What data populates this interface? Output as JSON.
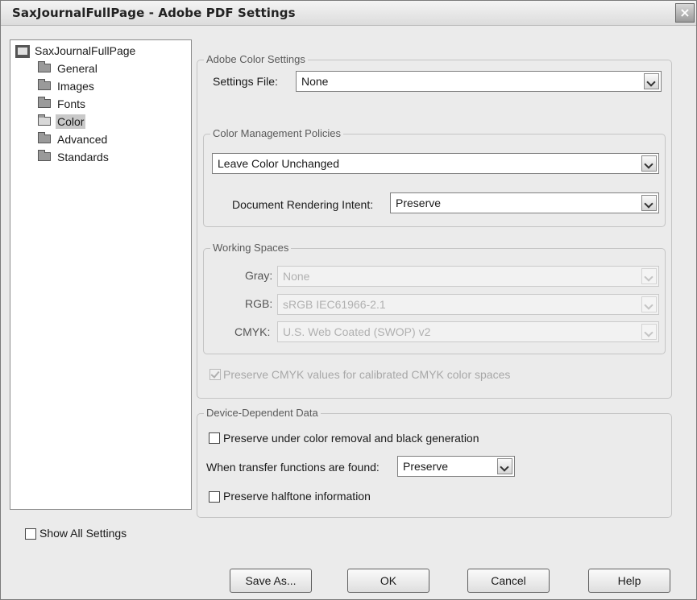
{
  "window": {
    "title": "SaxJournalFullPage - Adobe PDF Settings",
    "close_glyph": "×"
  },
  "tree": {
    "root": {
      "label": "SaxJournalFullPage",
      "icon": "settings-file-icon"
    },
    "items": [
      {
        "label": "General",
        "icon": "folder-icon"
      },
      {
        "label": "Images",
        "icon": "folder-icon"
      },
      {
        "label": "Fonts",
        "icon": "folder-icon"
      },
      {
        "label": "Color",
        "icon": "open-folder-icon",
        "selected": true
      },
      {
        "label": "Advanced",
        "icon": "folder-icon"
      },
      {
        "label": "Standards",
        "icon": "folder-icon"
      }
    ]
  },
  "color_settings": {
    "legend": "Adobe Color Settings",
    "settings_file_label": "Settings File:",
    "settings_file_value": "None"
  },
  "policies": {
    "legend": "Color Management Policies",
    "policy_value": "Leave Color Unchanged",
    "intent_label": "Document Rendering Intent:",
    "intent_value": "Preserve"
  },
  "working_spaces": {
    "legend": "Working Spaces",
    "gray_label": "Gray:",
    "gray_value": "None",
    "rgb_label": "RGB:",
    "rgb_value": "sRGB IEC61966-2.1",
    "cmyk_label": "CMYK:",
    "cmyk_value": "U.S. Web Coated (SWOP) v2"
  },
  "preserve_cmyk": {
    "label": "Preserve CMYK values for calibrated CMYK color spaces",
    "checked": true,
    "enabled": false
  },
  "device": {
    "legend": "Device-Dependent Data",
    "ucr_label": "Preserve under color removal and black generation",
    "ucr_checked": false,
    "transfer_label": "When transfer functions are found:",
    "transfer_value": "Preserve",
    "halftone_label": "Preserve halftone information",
    "halftone_checked": false
  },
  "show_all": {
    "label": "Show All Settings",
    "checked": false
  },
  "buttons": {
    "save_as": "Save As...",
    "ok": "OK",
    "cancel": "Cancel",
    "help": "Help"
  }
}
